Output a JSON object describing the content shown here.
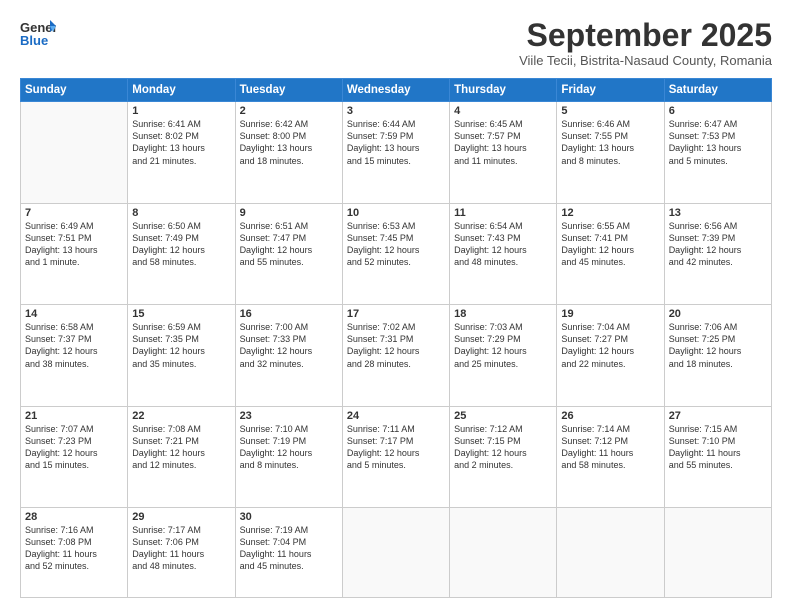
{
  "header": {
    "logo_general": "General",
    "logo_blue": "Blue",
    "month": "September 2025",
    "location": "Viile Tecii, Bistrita-Nasaud County, Romania"
  },
  "weekdays": [
    "Sunday",
    "Monday",
    "Tuesday",
    "Wednesday",
    "Thursday",
    "Friday",
    "Saturday"
  ],
  "weeks": [
    [
      {
        "day": "",
        "info": ""
      },
      {
        "day": "1",
        "info": "Sunrise: 6:41 AM\nSunset: 8:02 PM\nDaylight: 13 hours\nand 21 minutes."
      },
      {
        "day": "2",
        "info": "Sunrise: 6:42 AM\nSunset: 8:00 PM\nDaylight: 13 hours\nand 18 minutes."
      },
      {
        "day": "3",
        "info": "Sunrise: 6:44 AM\nSunset: 7:59 PM\nDaylight: 13 hours\nand 15 minutes."
      },
      {
        "day": "4",
        "info": "Sunrise: 6:45 AM\nSunset: 7:57 PM\nDaylight: 13 hours\nand 11 minutes."
      },
      {
        "day": "5",
        "info": "Sunrise: 6:46 AM\nSunset: 7:55 PM\nDaylight: 13 hours\nand 8 minutes."
      },
      {
        "day": "6",
        "info": "Sunrise: 6:47 AM\nSunset: 7:53 PM\nDaylight: 13 hours\nand 5 minutes."
      }
    ],
    [
      {
        "day": "7",
        "info": "Sunrise: 6:49 AM\nSunset: 7:51 PM\nDaylight: 13 hours\nand 1 minute."
      },
      {
        "day": "8",
        "info": "Sunrise: 6:50 AM\nSunset: 7:49 PM\nDaylight: 12 hours\nand 58 minutes."
      },
      {
        "day": "9",
        "info": "Sunrise: 6:51 AM\nSunset: 7:47 PM\nDaylight: 12 hours\nand 55 minutes."
      },
      {
        "day": "10",
        "info": "Sunrise: 6:53 AM\nSunset: 7:45 PM\nDaylight: 12 hours\nand 52 minutes."
      },
      {
        "day": "11",
        "info": "Sunrise: 6:54 AM\nSunset: 7:43 PM\nDaylight: 12 hours\nand 48 minutes."
      },
      {
        "day": "12",
        "info": "Sunrise: 6:55 AM\nSunset: 7:41 PM\nDaylight: 12 hours\nand 45 minutes."
      },
      {
        "day": "13",
        "info": "Sunrise: 6:56 AM\nSunset: 7:39 PM\nDaylight: 12 hours\nand 42 minutes."
      }
    ],
    [
      {
        "day": "14",
        "info": "Sunrise: 6:58 AM\nSunset: 7:37 PM\nDaylight: 12 hours\nand 38 minutes."
      },
      {
        "day": "15",
        "info": "Sunrise: 6:59 AM\nSunset: 7:35 PM\nDaylight: 12 hours\nand 35 minutes."
      },
      {
        "day": "16",
        "info": "Sunrise: 7:00 AM\nSunset: 7:33 PM\nDaylight: 12 hours\nand 32 minutes."
      },
      {
        "day": "17",
        "info": "Sunrise: 7:02 AM\nSunset: 7:31 PM\nDaylight: 12 hours\nand 28 minutes."
      },
      {
        "day": "18",
        "info": "Sunrise: 7:03 AM\nSunset: 7:29 PM\nDaylight: 12 hours\nand 25 minutes."
      },
      {
        "day": "19",
        "info": "Sunrise: 7:04 AM\nSunset: 7:27 PM\nDaylight: 12 hours\nand 22 minutes."
      },
      {
        "day": "20",
        "info": "Sunrise: 7:06 AM\nSunset: 7:25 PM\nDaylight: 12 hours\nand 18 minutes."
      }
    ],
    [
      {
        "day": "21",
        "info": "Sunrise: 7:07 AM\nSunset: 7:23 PM\nDaylight: 12 hours\nand 15 minutes."
      },
      {
        "day": "22",
        "info": "Sunrise: 7:08 AM\nSunset: 7:21 PM\nDaylight: 12 hours\nand 12 minutes."
      },
      {
        "day": "23",
        "info": "Sunrise: 7:10 AM\nSunset: 7:19 PM\nDaylight: 12 hours\nand 8 minutes."
      },
      {
        "day": "24",
        "info": "Sunrise: 7:11 AM\nSunset: 7:17 PM\nDaylight: 12 hours\nand 5 minutes."
      },
      {
        "day": "25",
        "info": "Sunrise: 7:12 AM\nSunset: 7:15 PM\nDaylight: 12 hours\nand 2 minutes."
      },
      {
        "day": "26",
        "info": "Sunrise: 7:14 AM\nSunset: 7:12 PM\nDaylight: 11 hours\nand 58 minutes."
      },
      {
        "day": "27",
        "info": "Sunrise: 7:15 AM\nSunset: 7:10 PM\nDaylight: 11 hours\nand 55 minutes."
      }
    ],
    [
      {
        "day": "28",
        "info": "Sunrise: 7:16 AM\nSunset: 7:08 PM\nDaylight: 11 hours\nand 52 minutes."
      },
      {
        "day": "29",
        "info": "Sunrise: 7:17 AM\nSunset: 7:06 PM\nDaylight: 11 hours\nand 48 minutes."
      },
      {
        "day": "30",
        "info": "Sunrise: 7:19 AM\nSunset: 7:04 PM\nDaylight: 11 hours\nand 45 minutes."
      },
      {
        "day": "",
        "info": ""
      },
      {
        "day": "",
        "info": ""
      },
      {
        "day": "",
        "info": ""
      },
      {
        "day": "",
        "info": ""
      }
    ]
  ]
}
